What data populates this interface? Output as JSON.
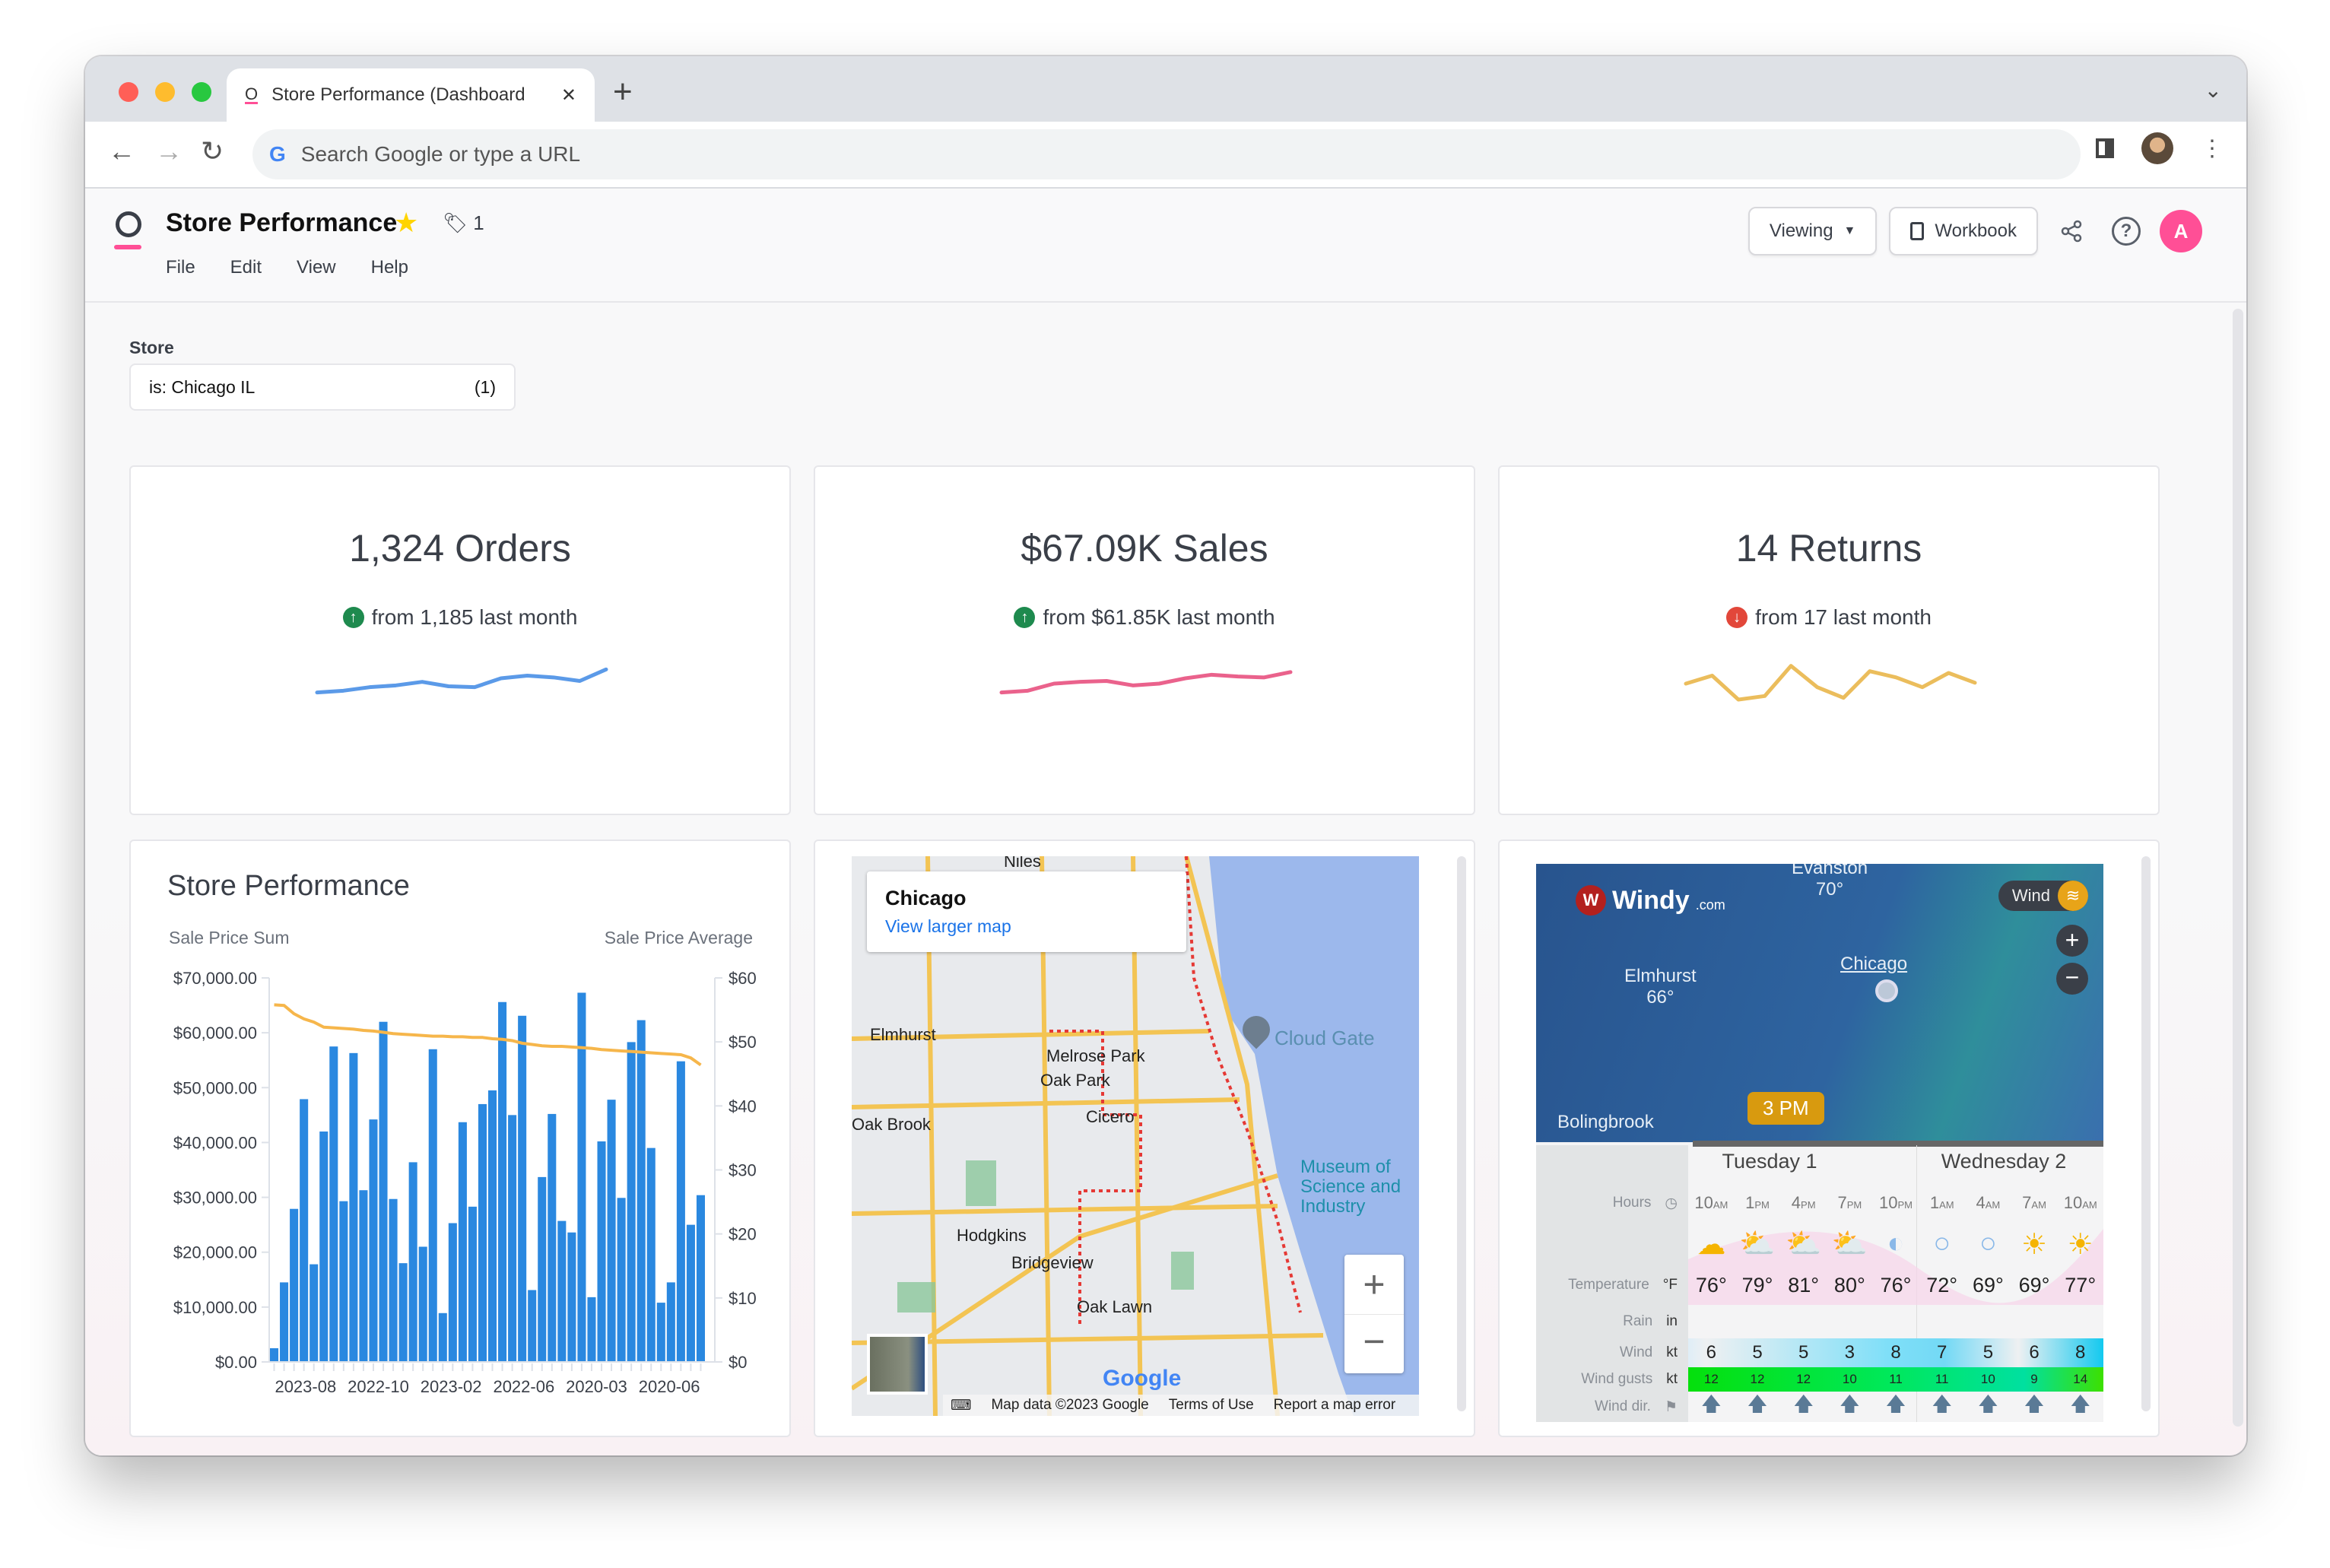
{
  "browser": {
    "tab_title": "Store Performance (Dashboard",
    "omnibox_placeholder": "Search Google or type a URL"
  },
  "app": {
    "title": "Store Performance",
    "tag_count": "1",
    "menus": [
      "File",
      "Edit",
      "View",
      "Help"
    ],
    "viewing_label": "Viewing",
    "workbook_label": "Workbook",
    "user_initial": "A",
    "accent": "#ff4f96"
  },
  "filter": {
    "label": "Store",
    "value": "is: Chicago IL",
    "count": "(1)"
  },
  "kpis": [
    {
      "value": "1,324 Orders",
      "sub": "from 1,185 last month",
      "trend": "up",
      "color": "#5b9ae8",
      "spark": [
        2,
        2.2,
        2.6,
        2.8,
        3.2,
        2.7,
        2.6,
        3.6,
        3.9,
        3.7,
        3.3,
        4.6
      ]
    },
    {
      "value": "$67.09K Sales",
      "sub": "from $61.85K last month",
      "trend": "up",
      "color": "#ea628c",
      "spark": [
        2,
        2.2,
        3.0,
        3.2,
        3.3,
        2.8,
        3.0,
        3.6,
        4.0,
        3.8,
        3.7,
        4.3
      ]
    },
    {
      "value": "14 Returns",
      "sub": "from 17 last month",
      "trend": "down",
      "color": "#ebbd5c",
      "spark": [
        3,
        3.9,
        1.2,
        1.6,
        5,
        2.6,
        1.4,
        4.4,
        3.7,
        2.6,
        4.2,
        3.1
      ]
    }
  ],
  "trend_colors": {
    "up": "#1e8a4e",
    "down": "#e2473a"
  },
  "chart_data": {
    "type": "bar",
    "title": "Store Performance",
    "ylabel": "Sale Price Sum",
    "y2label": "Sale Price Average",
    "ylim": [
      0,
      70000
    ],
    "y2lim": [
      0,
      60
    ],
    "yticks": [
      "$0.00",
      "$10,000.00",
      "$20,000.00",
      "$30,000.00",
      "$40,000.00",
      "$50,000.00",
      "$60,000.00",
      "$70,000.00"
    ],
    "y2ticks": [
      "$0",
      "$10",
      "$20",
      "$30",
      "$40",
      "$50",
      "$60"
    ],
    "xticklabels": [
      "2023-08",
      "2022-10",
      "2023-02",
      "2022-06",
      "2020-03",
      "2020-06"
    ],
    "bar_color": "#2a88e0",
    "line_color": "#f6b64b",
    "series": [
      {
        "name": "Sale Price Sum",
        "type": "bar",
        "values": [
          2500,
          14500,
          27900,
          47900,
          17800,
          42000,
          57500,
          29300,
          56300,
          31300,
          44200,
          62000,
          29700,
          18000,
          36400,
          21000,
          57000,
          8900,
          25300,
          43700,
          28300,
          47000,
          49500,
          65600,
          45000,
          63100,
          13100,
          33700,
          45200,
          25700,
          23600,
          67300,
          11800,
          40200,
          47800,
          29900,
          58300,
          62300,
          39000,
          10800,
          14500,
          54800,
          25000,
          30400
        ]
      },
      {
        "name": "Sale Price Average",
        "type": "line",
        "values": [
          55.8,
          55.7,
          54.4,
          53.6,
          53.1,
          52.3,
          52.2,
          52.1,
          52.0,
          51.8,
          51.7,
          51.5,
          51.3,
          51.2,
          51.1,
          51.0,
          50.9,
          50.9,
          50.8,
          50.8,
          50.7,
          50.7,
          50.5,
          50.4,
          50.2,
          49.8,
          49.6,
          49.4,
          49.3,
          49.3,
          49.2,
          49.1,
          49.0,
          48.8,
          48.7,
          48.6,
          48.5,
          48.4,
          48.3,
          48.2,
          48.1,
          48.0,
          47.5,
          46.4
        ]
      }
    ]
  },
  "map": {
    "place": "Chicago",
    "link": "View larger map",
    "poi": [
      "Cloud Gate",
      "Museum of Science and Industry"
    ],
    "labels": [
      "Niles",
      "Elmhurst",
      "Melrose Park",
      "Oak Park",
      "Cicero",
      "Oak Brook",
      "Hodgkins",
      "Bridgeview",
      "Oak Lawn"
    ],
    "footer": [
      "Map data ©2023 Google",
      "Terms of Use",
      "Report a map error"
    ]
  },
  "windy": {
    "brand": "Windy",
    "brand_suffix": ".com",
    "layer": "Wind",
    "cities": [
      {
        "name": "Evanston",
        "temp": "70°"
      },
      {
        "name": "Elmhurst",
        "temp": "66°"
      },
      {
        "name": "Chicago",
        "temp": ""
      },
      {
        "name": "Bolingbrook",
        "temp": ""
      }
    ],
    "time_marker": "3 PM",
    "days": [
      "Tuesday 1",
      "Wednesday 2"
    ],
    "row_labels": {
      "hours": "Hours",
      "temperature": "Temperature",
      "temp_unit": "°F",
      "rain": "Rain",
      "rain_unit": "in",
      "wind": "Wind",
      "wind_unit": "kt",
      "gusts": "Wind gusts",
      "gusts_unit": "kt",
      "dir": "Wind dir."
    },
    "hours": [
      [
        "10",
        "AM"
      ],
      [
        "1",
        "PM"
      ],
      [
        "4",
        "PM"
      ],
      [
        "7",
        "PM"
      ],
      [
        "10",
        "PM"
      ],
      [
        "1",
        "AM"
      ],
      [
        "4",
        "AM"
      ],
      [
        "7",
        "AM"
      ],
      [
        "10",
        "AM"
      ]
    ],
    "icons": [
      "☁",
      "⛅",
      "⛅",
      "⛅",
      "◐",
      "○",
      "○",
      "☀",
      "☀"
    ],
    "temps": [
      "76°",
      "79°",
      "81°",
      "80°",
      "76°",
      "72°",
      "69°",
      "69°",
      "77°"
    ],
    "wind": [
      "6",
      "5",
      "5",
      "3",
      "8",
      "7",
      "5",
      "6",
      "8"
    ],
    "gusts": [
      "12",
      "12",
      "12",
      "10",
      "11",
      "11",
      "10",
      "9",
      "14"
    ]
  }
}
